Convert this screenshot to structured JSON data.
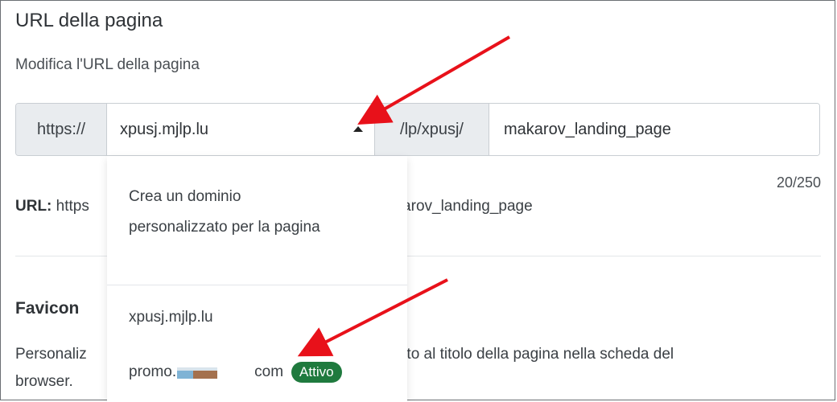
{
  "section": {
    "title": "URL della pagina",
    "description": "Modifica l'URL della pagina"
  },
  "url_field": {
    "protocol": "https://",
    "selected_domain": "xpusj.mjlp.lu",
    "path_prefix": "/lp/xpusj/",
    "slug_value": "makarov_landing_page",
    "char_counter": "20/250"
  },
  "url_preview": {
    "label": "URL:",
    "value_start": "https",
    "value_end": "/makarov_landing_page"
  },
  "favicon": {
    "title": "Favicon",
    "desc_start": "Personaliz",
    "desc_end": "accanto al titolo della pagina nella scheda del",
    "desc_line2": "browser."
  },
  "dropdown": {
    "create_option": "Crea un dominio personalizzato per la pagina",
    "options": [
      {
        "label": "xpusj.mjlp.lu"
      },
      {
        "label_start": "promo.",
        "label_end": "com",
        "badge": "Attivo"
      }
    ]
  },
  "colors": {
    "badge_bg": "#1f7a3e",
    "arrow": "#e8111a",
    "addon_bg": "#e9ecef"
  }
}
